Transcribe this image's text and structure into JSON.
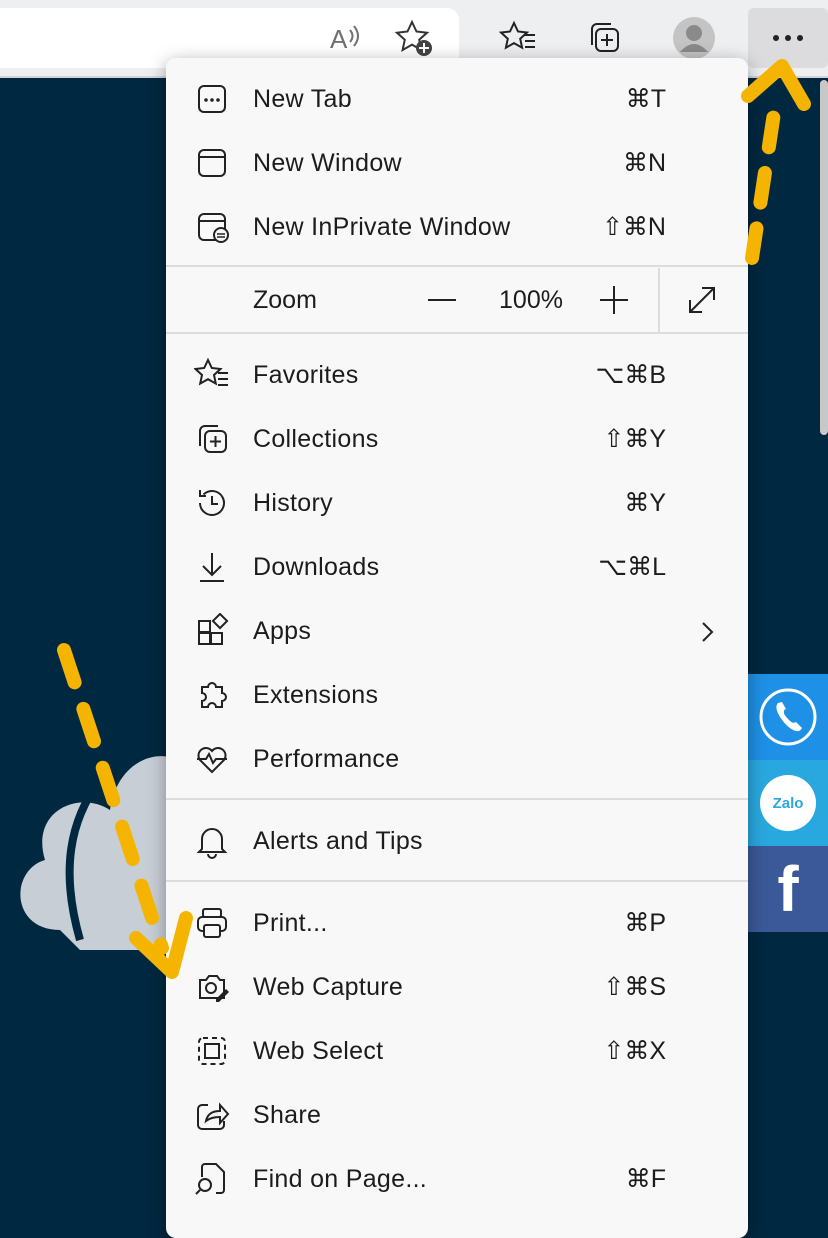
{
  "menu": {
    "items_top": [
      {
        "label": "New Tab",
        "shortcut": "⌘T",
        "icon": "new-tab-icon"
      },
      {
        "label": "New Window",
        "shortcut": "⌘N",
        "icon": "new-window-icon"
      },
      {
        "label": "New InPrivate Window",
        "shortcut": "⇧⌘N",
        "icon": "inprivate-icon"
      }
    ],
    "zoom": {
      "label": "Zoom",
      "value": "100%"
    },
    "items_mid": [
      {
        "label": "Favorites",
        "shortcut": "⌥⌘B",
        "icon": "favorites-icon"
      },
      {
        "label": "Collections",
        "shortcut": "⇧⌘Y",
        "icon": "collections-icon"
      },
      {
        "label": "History",
        "shortcut": "⌘Y",
        "icon": "history-icon"
      },
      {
        "label": "Downloads",
        "shortcut": "⌥⌘L",
        "icon": "downloads-icon"
      },
      {
        "label": "Apps",
        "shortcut": "",
        "icon": "apps-icon"
      },
      {
        "label": "Extensions",
        "shortcut": "",
        "icon": "extensions-icon"
      },
      {
        "label": "Performance",
        "shortcut": "",
        "icon": "performance-icon"
      }
    ],
    "alerts": {
      "label": "Alerts and Tips",
      "icon": "bell-icon"
    },
    "items_bottom": [
      {
        "label": "Print...",
        "shortcut": "⌘P",
        "icon": "print-icon"
      },
      {
        "label": "Web Capture",
        "shortcut": "⇧⌘S",
        "icon": "web-capture-icon"
      },
      {
        "label": "Web Select",
        "shortcut": "⇧⌘X",
        "icon": "web-select-icon"
      },
      {
        "label": "Share",
        "shortcut": "",
        "icon": "share-icon"
      },
      {
        "label": "Find on Page...",
        "shortcut": "⌘F",
        "icon": "find-icon"
      }
    ]
  },
  "toolbar": {
    "icons": [
      "read-aloud-icon",
      "add-favorite-icon",
      "favorites-icon",
      "collections-icon",
      "profile-icon",
      "more-icon"
    ]
  },
  "social": {
    "zalo_label": "Zalo",
    "facebook_label": "f"
  },
  "colors": {
    "page_background": "#002840",
    "menu_background": "#f8f8f9",
    "highlight": "#fff200",
    "arrow": "#f5b400",
    "phone": "#1e90e6",
    "zalo": "#29a8df",
    "facebook": "#3b5998"
  }
}
